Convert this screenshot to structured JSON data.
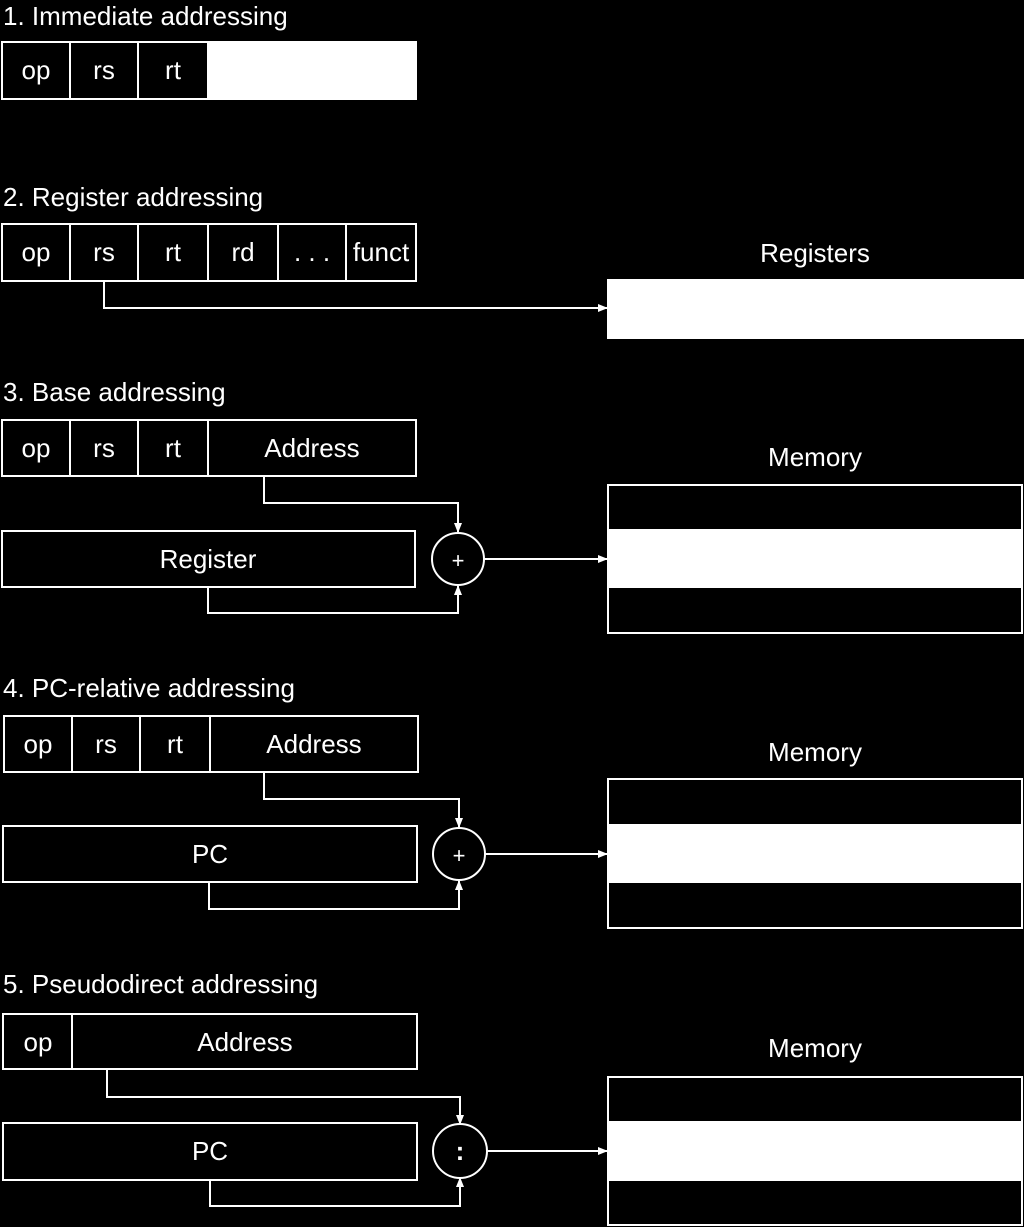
{
  "colors": {
    "background": "#000000",
    "foreground": "#ffffff"
  },
  "sections": [
    {
      "title": "1.  Immediate addressing",
      "fields": [
        "op",
        "rs",
        "rt",
        ""
      ]
    },
    {
      "title": "2. Register addressing",
      "fields": [
        "op",
        "rs",
        "rt",
        "rd",
        ". . .",
        "funct"
      ],
      "target": "Registers"
    },
    {
      "title": "3.  Base addressing",
      "fields": [
        "op",
        "rs",
        "rt",
        "Address"
      ],
      "source": "Register",
      "operator": "+",
      "target": "Memory"
    },
    {
      "title": "4.  PC-relative addressing",
      "fields": [
        "op",
        "rs",
        "rt",
        "Address"
      ],
      "source": "PC",
      "operator": "+",
      "target": "Memory"
    },
    {
      "title": "5.  Pseudodirect addressing",
      "fields": [
        "op",
        "Address"
      ],
      "source": "PC",
      "operator": ":",
      "target": "Memory"
    }
  ]
}
